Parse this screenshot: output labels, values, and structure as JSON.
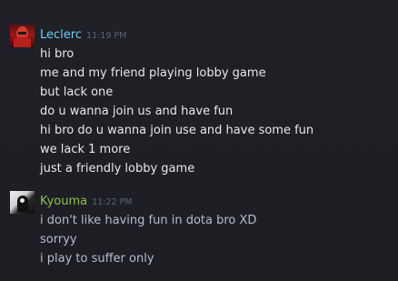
{
  "messages": [
    {
      "user": "Leclerc",
      "time": "11:19 PM",
      "lines": [
        "hi bro",
        "me and my friend playing lobby game",
        "but lack one",
        "do u wanna join us and have fun",
        "hi bro do u wanna join use and have some fun",
        "we lack 1 more",
        "just a friendly lobby game"
      ]
    },
    {
      "user": "Kyouma",
      "time": "11:22 PM",
      "lines": [
        "i don't like having fun in dota bro XD",
        "sorryy",
        "i play to suffer only"
      ]
    }
  ],
  "colors": {
    "background": "#1e2025",
    "leclerc_name": "#6dcff6",
    "kyouma_name": "#8fbf54",
    "timestamp": "#5f6570",
    "message_text": "#e6e8ea"
  },
  "icons": {
    "leclerc_avatar": "leclerc-avatar-icon",
    "kyouma_avatar": "kyouma-avatar-icon"
  }
}
